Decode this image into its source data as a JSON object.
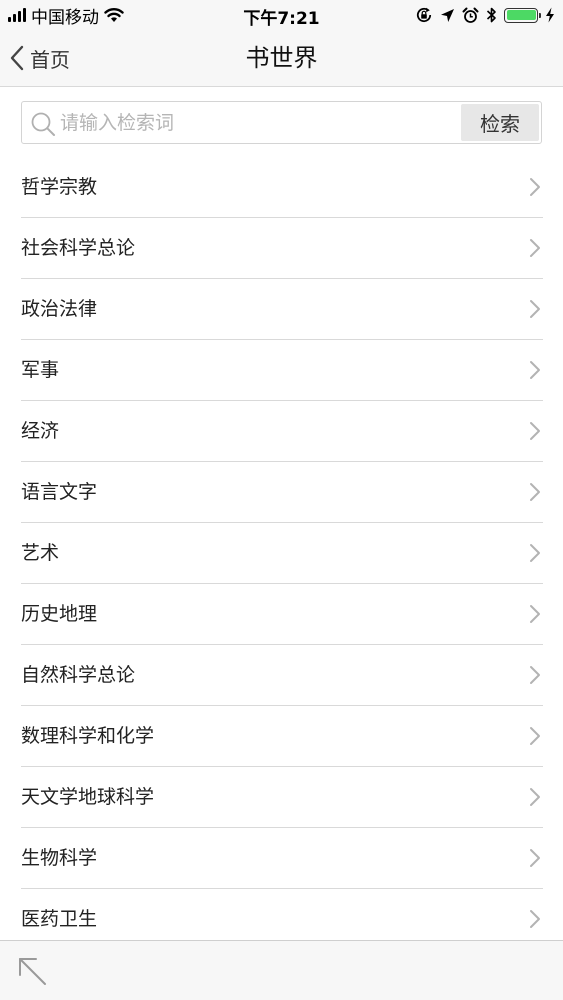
{
  "status_bar": {
    "carrier": "中国移动",
    "time": "下午7:21"
  },
  "nav": {
    "back_label": "首页",
    "title": "书世界"
  },
  "search": {
    "placeholder": "请输入检索词",
    "value": "",
    "button_label": "检索"
  },
  "categories": [
    {
      "label": "哲学宗教"
    },
    {
      "label": "社会科学总论"
    },
    {
      "label": "政治法律"
    },
    {
      "label": "军事"
    },
    {
      "label": "经济"
    },
    {
      "label": "语言文字"
    },
    {
      "label": "艺术"
    },
    {
      "label": "历史地理"
    },
    {
      "label": "自然科学总论"
    },
    {
      "label": "数理科学和化学"
    },
    {
      "label": "天文学地球科学"
    },
    {
      "label": "生物科学"
    },
    {
      "label": "医药卫生"
    }
  ],
  "icons": {
    "signal": "signal-bars-icon",
    "wifi": "wifi-icon",
    "orientation_lock": "orientation-lock-icon",
    "location": "location-arrow-icon",
    "alarm": "alarm-clock-icon",
    "bluetooth": "bluetooth-icon",
    "battery": "battery-icon",
    "charging": "charging-bolt-icon",
    "back": "chevron-left-icon",
    "search": "search-icon",
    "row_chevron": "chevron-right-icon",
    "expand": "arrow-up-left-icon"
  },
  "colors": {
    "battery": "#4cd964",
    "bar_background": "#f7f7f7",
    "divider": "#d9d9d9",
    "button_background": "#e7e7e7",
    "placeholder": "#b5b5b5"
  }
}
